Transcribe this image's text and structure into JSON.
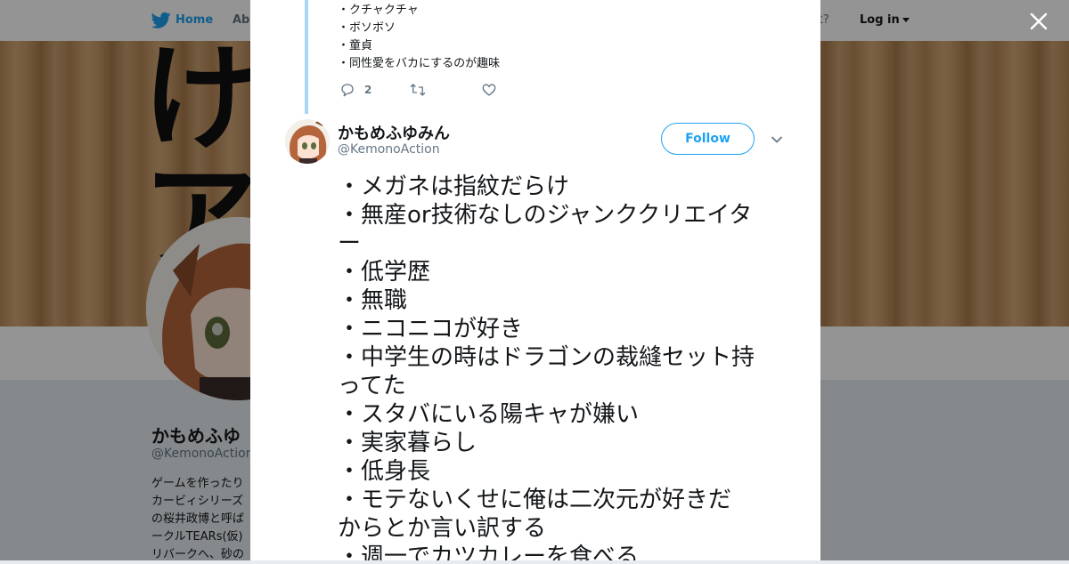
{
  "topnav": {
    "home_label": "Home",
    "about_label": "Abo",
    "account_text": "ccount?",
    "login_label": "Log in"
  },
  "banner": {
    "glyphs": [
      "け",
      "ア"
    ]
  },
  "profile": {
    "name": "かもめふゆ",
    "handle": "@KemonoAction",
    "bio_lines": [
      "ゲームを作ったり",
      "カービィシリーズ",
      "の桜井政博と呼ば",
      "ークルTEARs(仮)",
      "リバークへ、砂の"
    ]
  },
  "previous_tweet": {
    "lines": [
      "・クチャクチャ",
      "・ボソボソ",
      "・童貞",
      "・同性愛をバカにするのが趣味"
    ],
    "reply_count": "2"
  },
  "tweet": {
    "author_name": "かもめふゆみん",
    "author_handle": "@KemonoAction",
    "follow_label": "Follow",
    "lines": [
      "・メガネは指紋だらけ",
      "・無産or技術なしのジャンククリエイタ",
      "ー",
      "・低学歴",
      "・無職",
      "・ニコニコが好き",
      "・中学生の時はドラゴンの裁縫セット持",
      "ってた",
      "・スタバにいる陽キャが嫌い",
      "・実家暮らし",
      "・低身長",
      "・モテないくせに俺は二次元が好きだ",
      "からとか言い訳する",
      "・週一でカツカレーを食べる"
    ]
  },
  "colors": {
    "brand": "#1da1f2",
    "thread_line": "#a8d6f5",
    "text": "#14171a",
    "secondary": "#657786"
  },
  "icons": [
    "twitter-bird-icon",
    "close-icon",
    "reply-icon",
    "retweet-icon",
    "like-icon",
    "chevron-down-icon"
  ]
}
